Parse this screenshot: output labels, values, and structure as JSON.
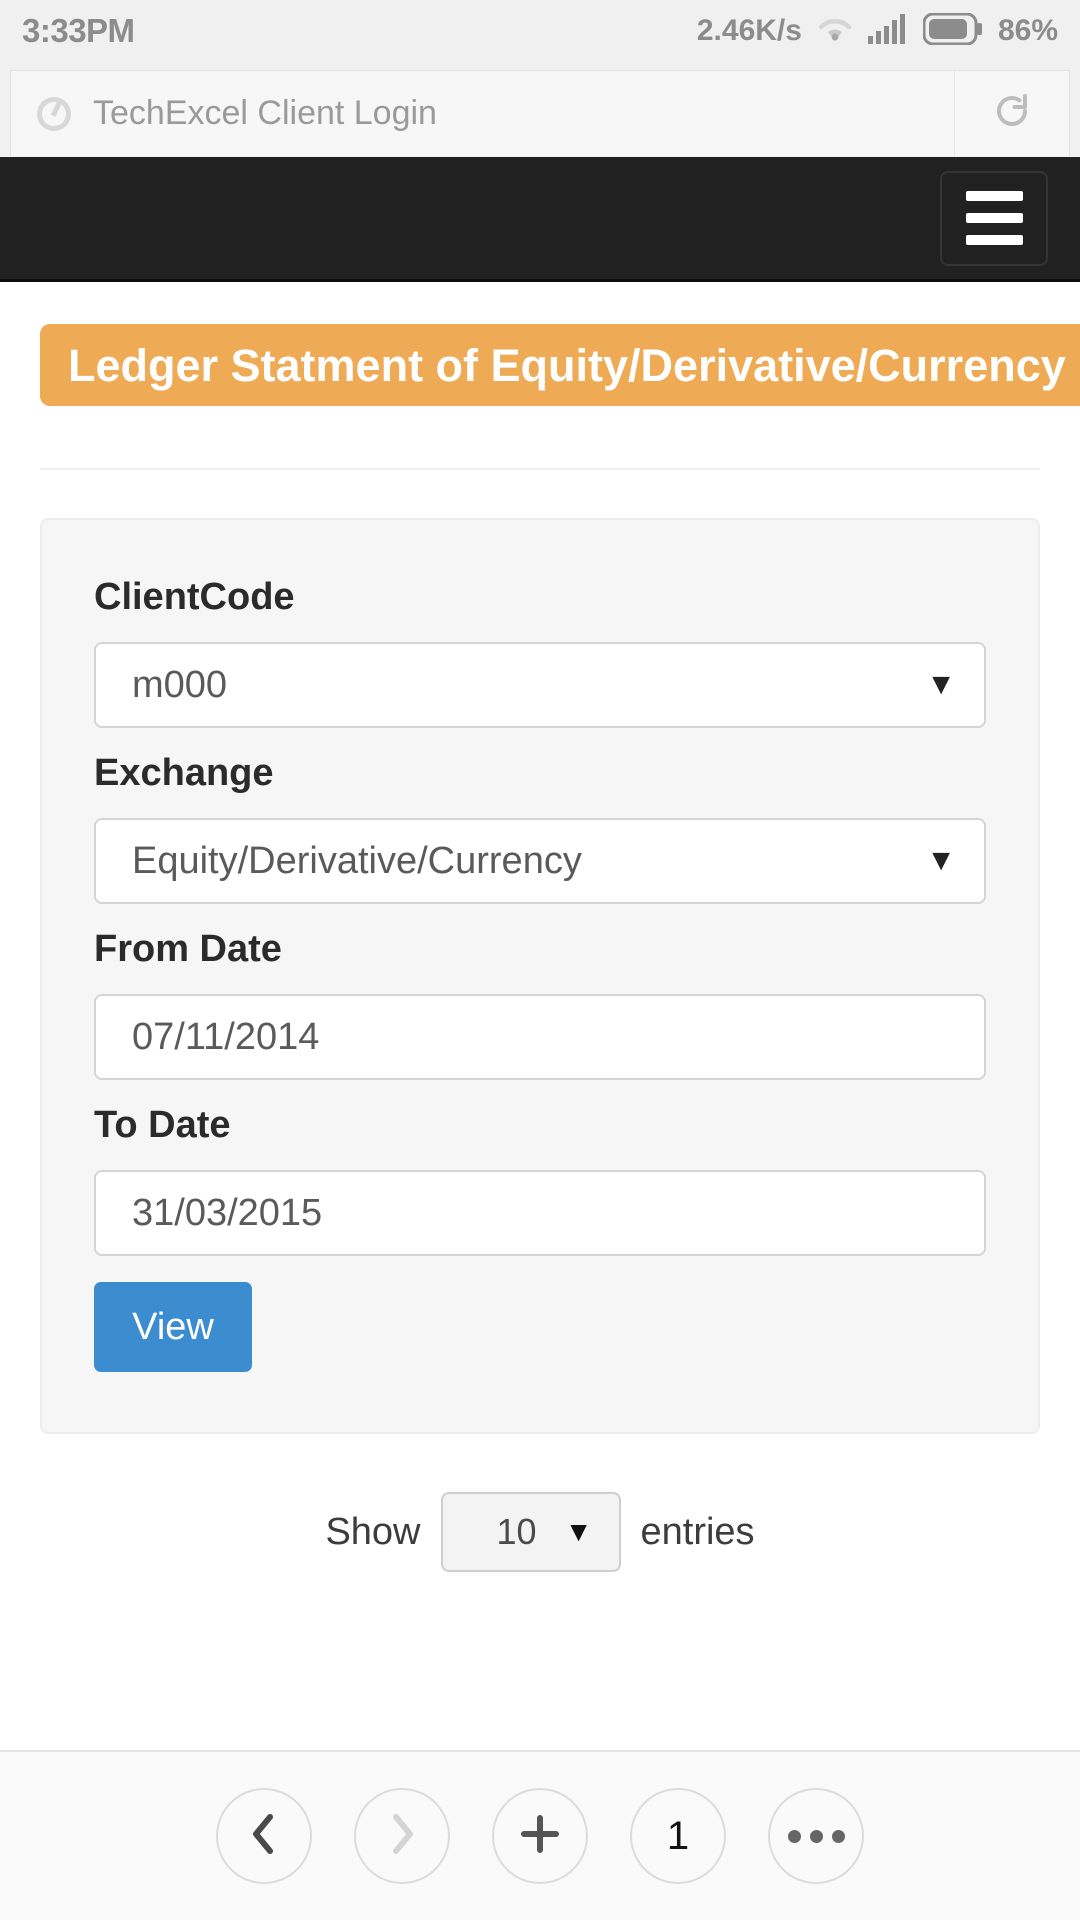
{
  "status_bar": {
    "time": "3:33PM",
    "network_speed": "2.46K/s",
    "battery_percent": "86%",
    "icons": [
      "wifi-icon",
      "signal-icon",
      "battery-icon"
    ]
  },
  "browser": {
    "url_bar": {
      "title": "TechExcel Client Login",
      "favicon": "page-globe-icon",
      "refresh_icon": "refresh-icon"
    },
    "bottom_toolbar": {
      "back_label": "‹",
      "forward_label": "›",
      "new_tab_label": "+",
      "tab_count": "1",
      "menu_label": "•••"
    }
  },
  "navbar": {
    "menu_icon": "hamburger-icon",
    "background": "#212121"
  },
  "banner": {
    "title": "Ledger Statment of Equity/Derivative/Currency",
    "background": "#eeaa55"
  },
  "form": {
    "fields": [
      {
        "label": "ClientCode",
        "value": "m000",
        "type": "select",
        "caret": "▼"
      },
      {
        "label": "Exchange",
        "value": "Equity/Derivative/Currency",
        "type": "select",
        "caret": "▼"
      },
      {
        "label": "From Date",
        "value": "07/11/2014",
        "type": "date",
        "caret": ""
      },
      {
        "label": "To Date",
        "value": "31/03/2015",
        "type": "date",
        "caret": ""
      }
    ],
    "submit_label": "View",
    "submit_color": "#3b8dd0"
  },
  "table_controls": {
    "show_label": "Show",
    "entries_value": "10",
    "entries_label": "entries",
    "entries_caret": "▼"
  }
}
